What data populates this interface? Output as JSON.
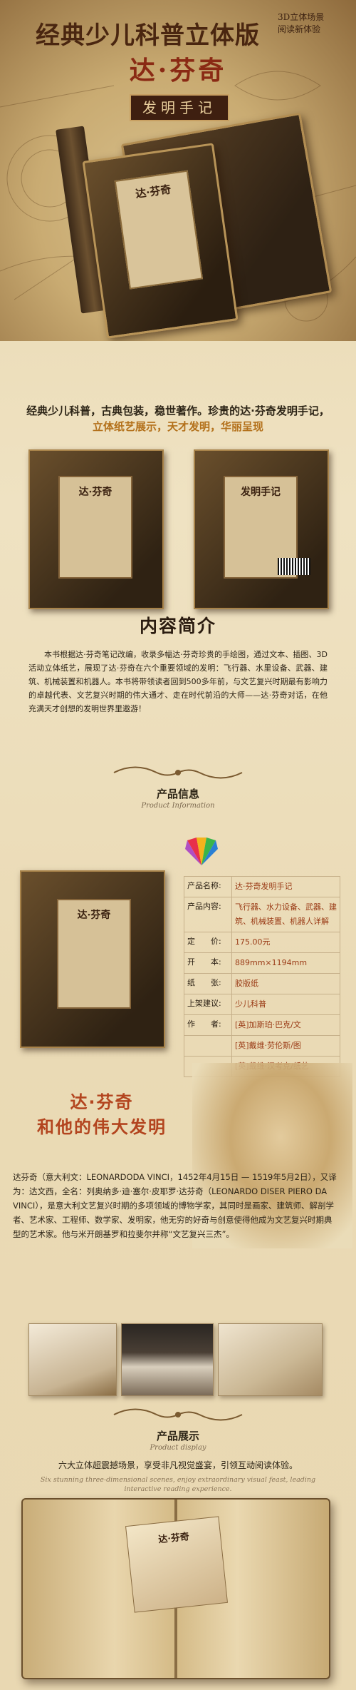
{
  "hero": {
    "title": "经典少儿科普立体版",
    "sub_line1": "3D立体场景",
    "sub_line2": "阅读新体验",
    "name": "达·芬奇",
    "badge": "发明手记",
    "book_label": "达·芬奇"
  },
  "tagline": {
    "line1": "经典少儿科普，古典包装，稳世著作。珍贵的达·芬奇发明手记，",
    "line2": "立体纸艺展示，天才发明，华丽呈现"
  },
  "covers": {
    "left_label": "达·芬奇",
    "right_label": "发明手记"
  },
  "intro": {
    "title": "内容简介",
    "text": "本书根据达·芬奇笔记改编，收录多幅达·芬奇珍贵的手绘图，通过文本、插图、3D活动立体纸艺，展现了达·芬奇在六个重要领域的发明：飞行器、水里设备、武器、建筑、机械装置和机器人。本书将带领读者回到500多年前，与文艺复兴时期最有影响力的卓越代表、文艺复兴时期的伟大通才、走在时代前沿的大师——达·芬奇对话，在他充满天才创想的发明世界里遨游！"
  },
  "product_info": {
    "title_cn": "产品信息",
    "title_en": "Product Information",
    "rows": [
      {
        "key": "产品名称:",
        "value": "达·芬奇发明手记"
      },
      {
        "key": "产品内容:",
        "value": "飞行器、水力设备、武器、建筑、机械装置、机器人详解"
      },
      {
        "key": "定　　价:",
        "value": "175.00元"
      },
      {
        "key": "开　　本:",
        "value": "889mm×1194mm"
      },
      {
        "key": "纸　　张:",
        "value": "胶版纸"
      },
      {
        "key": "上架建议:",
        "value": "少儿科普"
      },
      {
        "key": "作　　者:",
        "value": "[英]加斯珀·巴克/文"
      },
      {
        "key": "",
        "value": "[英]戴维·劳伦斯/图"
      },
      {
        "key": "",
        "value": "[英]戴维·汉考克/纸艺"
      }
    ]
  },
  "davinci": {
    "title_line1": "达·芬奇",
    "title_line2": "和他的伟大发明",
    "text": "达芬奇（意大利文：LEONARDODA VINCI，1452年4月15日 — 1519年5月2日），又译为：达文西，全名：列奥纳多·迪·塞尔·皮耶罗·达芬奇（LEONARDO DISER PIERO DA VINCI），是意大利文艺复兴时期的多项领域的博物学家，其同时是画家、建筑师、解剖学者、艺术家、工程师、数学家、发明家，他无穷的好奇与创意使得他成为文艺复兴时期典型的艺术家。他与米开朗基罗和拉斐尔并称“文艺复兴三杰”。"
  },
  "display": {
    "title_cn": "产品展示",
    "title_en": "Product display",
    "text": "六大立体超震撼场景，享受非凡视觉盛宴，引领互动阅读体验。",
    "text_en": "Six stunning three-dimensional scenes, enjoy extraordinary visual feast, leading interactive reading experience.",
    "book_label": "达·芬奇"
  }
}
